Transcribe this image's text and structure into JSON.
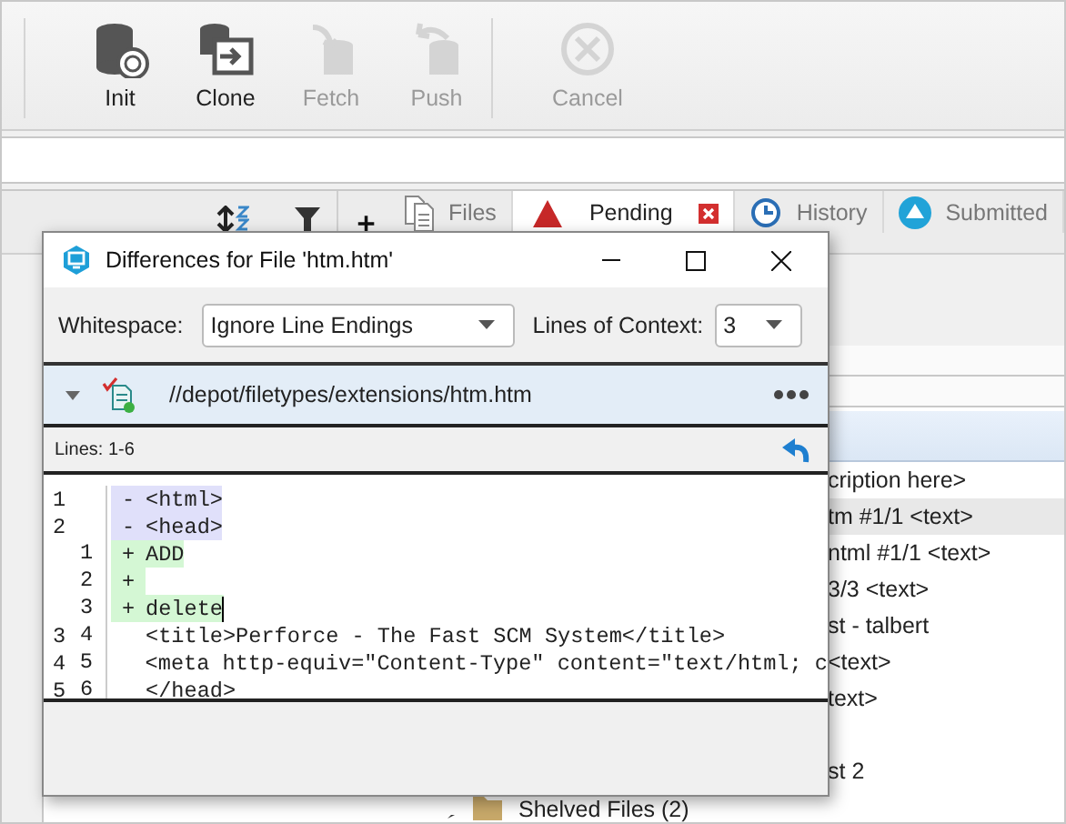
{
  "toolbar": {
    "buttons": [
      {
        "label": "Init",
        "kind": "init",
        "disabled": false
      },
      {
        "label": "Clone",
        "kind": "clone",
        "disabled": false
      },
      {
        "label": "Fetch",
        "kind": "fetch",
        "disabled": true
      },
      {
        "label": "Push",
        "kind": "push",
        "disabled": true
      },
      {
        "label": "Cancel",
        "kind": "cancel",
        "disabled": true
      }
    ]
  },
  "tabs": [
    {
      "label": "Files",
      "kind": "files",
      "selected": false,
      "closable": false
    },
    {
      "label": "Pending",
      "kind": "pending",
      "selected": true,
      "closable": true
    },
    {
      "label": "History",
      "kind": "history",
      "selected": false,
      "closable": false
    },
    {
      "label": "Submitted",
      "kind": "submitted",
      "selected": false,
      "closable": false
    }
  ],
  "list_rows": [
    {
      "text": "cription here>",
      "selected": false
    },
    {
      "text": "tm #1/1 <text>",
      "selected": true
    },
    {
      "text": "ntml #1/1 <text>",
      "selected": false
    },
    {
      "text": "3/3 <text>",
      "selected": false
    },
    {
      "text": "st - talbert",
      "selected": false
    },
    {
      "text": "<text>",
      "selected": false
    },
    {
      "text": "text>",
      "selected": false
    },
    {
      "selected": false
    },
    {
      "text": "st 2",
      "selected": false
    }
  ],
  "shelved": {
    "label": "Shelved Files (2)"
  },
  "dialog": {
    "title": "Differences for File 'htm.htm'",
    "whitespace_label": "Whitespace:",
    "whitespace_value": "Ignore Line Endings",
    "context_label": "Lines of Context:",
    "context_value": "3",
    "file_path": "//depot/filetypes/extensions/htm.htm",
    "lines_label": "Lines: 1-6",
    "diff_lines": [
      {
        "kind": "removed",
        "old": "1",
        "sign": "-",
        "text": "<html>"
      },
      {
        "kind": "removed",
        "old": "2",
        "sign": "-",
        "text": "<head>"
      },
      {
        "kind": "added",
        "new": "1",
        "sign": "+",
        "text": "ADD"
      },
      {
        "kind": "added",
        "new": "2",
        "sign": "+"
      },
      {
        "kind": "added",
        "new": "3",
        "sign": "+",
        "text": "delete",
        "cursor": true
      },
      {
        "kind": "context",
        "old": "3",
        "new": "4",
        "text": "<title>Perforce - The Fast SCM System</title>"
      },
      {
        "kind": "context",
        "old": "4",
        "new": "5",
        "text": "<meta http-equiv=\"Content-Type\" content=\"text/html; c"
      },
      {
        "kind": "context",
        "old": "5",
        "new": "6",
        "text": "</head>"
      }
    ]
  }
}
